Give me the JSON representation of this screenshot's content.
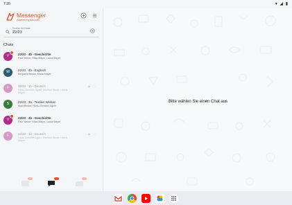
{
  "status_bar": {
    "time": "7:26",
    "system_icons": "▾ ◢ ▮"
  },
  "app": {
    "brand": "Messenger",
    "brand_sub": "powered by sdui.com",
    "accent": "#d9542c"
  },
  "search": {
    "placeholder": "Suche in Chats",
    "value": "22/23"
  },
  "section_title": "Chats",
  "chats": [
    {
      "initial": "V",
      "color": "#b02a8a",
      "title": "22/23 · 4b - Geschichte",
      "members": "Paul Weber, Elias Mayer, Laura Mayer",
      "bold": true,
      "unread": true,
      "muted": false
    },
    {
      "initial": "M",
      "color": "#2f5b73",
      "title": "22/23 · 4b - Englisch",
      "members": "Benjamin Moser, Maria Mayer",
      "bold": false,
      "unread": false,
      "muted": false
    },
    {
      "initial": "F",
      "color": "#b02a8a",
      "title": "22/23 · 1b - Deutsch",
      "members": "Hans-Christian Agner, Manfred Bauer, Laura",
      "members2": "Mayer",
      "bold": false,
      "unread": false,
      "muted": true
    },
    {
      "initial": "S",
      "color": "#3a7a3f",
      "title": "22/23 · 3a - Textiles Werken",
      "members": "Mark Binder, Hans-Christian Agner",
      "bold": false,
      "unread": false,
      "muted": false
    },
    {
      "initial": "V",
      "color": "#b02a8a",
      "title": "22/23 · 4b - Geschichte",
      "members": "Paul Weber, Elias Mayer, Laura Mayer",
      "bold": true,
      "unread": true,
      "muted": false
    },
    {
      "initial": "F",
      "color": "#b02a8a",
      "title": "22/23 · 1b - Deutsch",
      "members": "Hans-Christian Agner, Manfred Bauer, Laura",
      "members2": "Mayer",
      "bold": false,
      "unread": false,
      "muted": true
    }
  ],
  "empty_state": "Bitte wählen Sie einen Chat aus",
  "bottom_nav": [
    "news",
    "chats",
    "files"
  ],
  "taskbar_apps": [
    "Gmail",
    "Chrome",
    "YouTube",
    "Photos",
    "App drawer"
  ]
}
